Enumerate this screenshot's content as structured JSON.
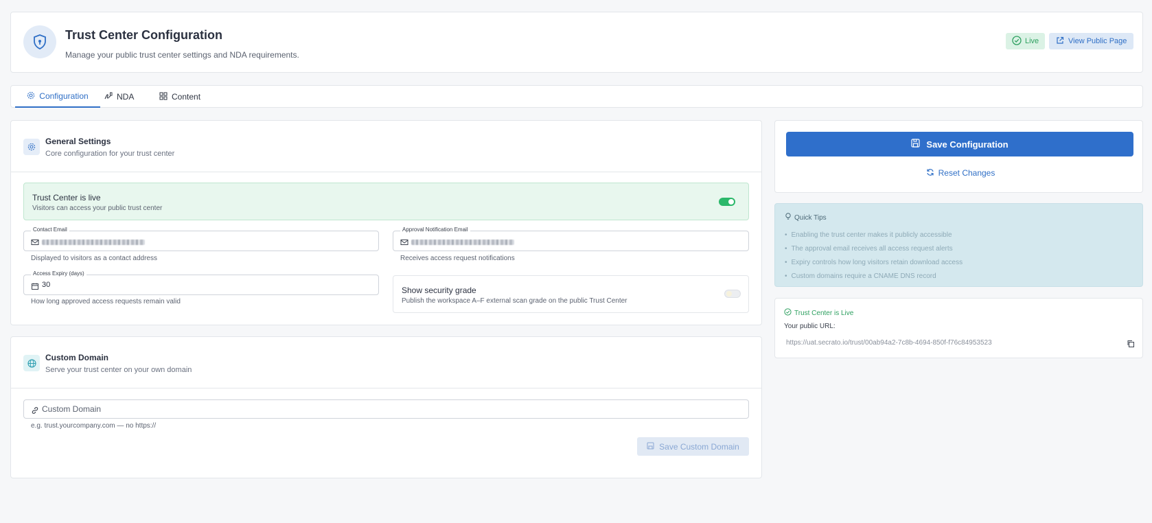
{
  "header": {
    "title": "Trust Center Configuration",
    "subtitle": "Manage your public trust center settings and NDA requirements.",
    "live_badge": "Live",
    "view_public_label": "View Public Page"
  },
  "tabs": [
    {
      "label": "Configuration",
      "icon": "gear-icon",
      "active": true
    },
    {
      "label": "NDA",
      "icon": "signature-icon",
      "active": false
    },
    {
      "label": "Content",
      "icon": "grid-icon",
      "active": false
    }
  ],
  "general": {
    "title": "General Settings",
    "subtitle": "Core configuration for your trust center",
    "live_title": "Trust Center is live",
    "live_sub": "Visitors can access your public trust center",
    "live_enabled": true,
    "contact_label": "Contact Email",
    "contact_help": "Displayed to visitors as a contact address",
    "approval_label": "Approval Notification Email",
    "approval_help": "Receives access request notifications",
    "expiry_label": "Access Expiry (days)",
    "expiry_value": "30",
    "expiry_help": "How long approved access requests remain valid",
    "grade_title": "Show security grade",
    "grade_sub": "Publish the workspace A–F external scan grade on the public Trust Center",
    "grade_enabled": false
  },
  "domain": {
    "title": "Custom Domain",
    "subtitle": "Serve your trust center on your own domain",
    "placeholder": "Custom Domain",
    "help": "e.g. trust.yourcompany.com — no https://",
    "save_label": "Save Custom Domain"
  },
  "actions": {
    "save_label": "Save Configuration",
    "reset_label": "Reset Changes"
  },
  "tips": {
    "title": "Quick Tips",
    "items": [
      "Enabling the trust center makes it publicly accessible",
      "The approval email receives all access request alerts",
      "Expiry controls how long visitors retain download access",
      "Custom domains require a CNAME DNS record"
    ]
  },
  "status": {
    "title": "Trust Center is Live",
    "url_label": "Your public URL:",
    "url": "https://uat.secrato.io/trust/00ab94a2-7c8b-4694-850f-f76c84953523"
  },
  "colors": {
    "primary": "#2f6fcb",
    "success": "#2ea060",
    "toggle_on": "#2bb86a"
  }
}
